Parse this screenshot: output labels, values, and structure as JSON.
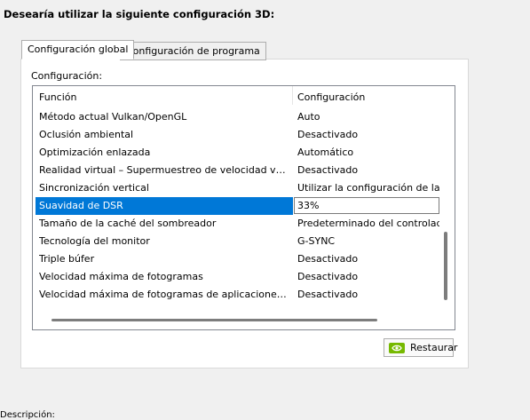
{
  "heading": "Desearía utilizar la siguiente configuración 3D:",
  "tabs": [
    {
      "label": "Configuración global",
      "active": true
    },
    {
      "label": "Configuración de programa",
      "active": false
    }
  ],
  "settings_label": "Configuración:",
  "table": {
    "columns": [
      "Función",
      "Configuración"
    ],
    "rows": [
      {
        "feature": "Método actual Vulkan/OpenGL",
        "value": "Auto"
      },
      {
        "feature": "Oclusión ambiental",
        "value": "Desactivado"
      },
      {
        "feature": "Optimización enlazada",
        "value": "Automático"
      },
      {
        "feature": "Realidad virtual – Supermuestreo de velocidad variable",
        "value": "Desactivado"
      },
      {
        "feature": "Sincronización vertical",
        "value": "Utilizar la configuración de la aplic"
      },
      {
        "feature": "Suavidad de DSR",
        "value": "33%"
      },
      {
        "feature": "Tamaño de la caché del sombreador",
        "value": "Predeterminado del controlador"
      },
      {
        "feature": "Tecnología del monitor",
        "value": "G-SYNC"
      },
      {
        "feature": "Triple búfer",
        "value": "Desactivado"
      },
      {
        "feature": "Velocidad máxima de fotogramas",
        "value": "Desactivado"
      },
      {
        "feature": "Velocidad máxima de fotogramas de aplicaciones en seg...",
        "value": "Desactivado"
      }
    ],
    "selected_index": 5
  },
  "restore_button": {
    "label": "Restaurar",
    "icon": "nvidia-logo-icon",
    "accent": "#76b900"
  },
  "description_label": "Descripción:",
  "colors": {
    "selection": "#0078d7",
    "panel": "#ffffff",
    "window": "#f0f0f0"
  }
}
